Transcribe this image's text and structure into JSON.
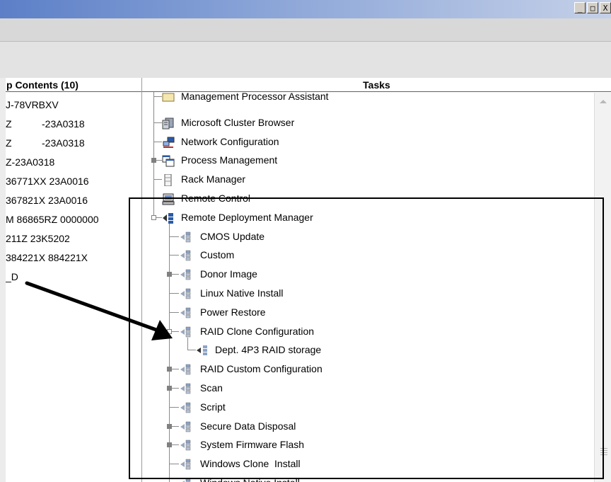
{
  "window": {
    "buttons": [
      "_",
      "□",
      "X"
    ]
  },
  "left_pane": {
    "header": "p Contents (10)",
    "rows": [
      {
        "c1": "J-78VRBXV",
        "c2": ""
      },
      {
        "c1": "Z",
        "c2": "-23A0318"
      },
      {
        "c1": "Z",
        "c2": "-23A0318"
      },
      {
        "c1": "Z-23A0318",
        "c2": ""
      },
      {
        "c1": "36771XX 23A0016",
        "c2": ""
      },
      {
        "c1": "367821X 23A0016",
        "c2": ""
      },
      {
        "c1": "M 86865RZ 0000000",
        "c2": ""
      },
      {
        "c1": "211Z 23K5202",
        "c2": ""
      },
      {
        "c1": "384221X 884221X",
        "c2": ""
      },
      {
        "c1": "_D",
        "c2": ""
      }
    ]
  },
  "tasks_pane": {
    "header": "Tasks",
    "items": [
      {
        "label": "Management Processor Assistant",
        "icon": "folder-icon"
      },
      {
        "label": "Microsoft Cluster Browser",
        "icon": "cluster-icon"
      },
      {
        "label": "Network Configuration",
        "icon": "network-icon"
      },
      {
        "label": "Process Management",
        "icon": "windows-icon"
      },
      {
        "label": "Rack Manager",
        "icon": "rack-icon"
      },
      {
        "label": "Remote Control",
        "icon": "monitor-icon"
      },
      {
        "label": "Remote Deployment Manager",
        "icon": "rdm-icon"
      },
      {
        "label": "CMOS Update",
        "icon": "rdm-task-icon"
      },
      {
        "label": "Custom",
        "icon": "rdm-task-icon"
      },
      {
        "label": "Donor Image",
        "icon": "rdm-task-icon"
      },
      {
        "label": "Linux Native Install",
        "icon": "rdm-task-icon"
      },
      {
        "label": "Power Restore",
        "icon": "rdm-task-icon"
      },
      {
        "label": "RAID Clone Configuration",
        "icon": "rdm-task-icon"
      },
      {
        "label": "Dept. 4P3 RAID storage",
        "icon": "rdm-job-icon"
      },
      {
        "label": "RAID Custom Configuration",
        "icon": "rdm-task-icon"
      },
      {
        "label": "Scan",
        "icon": "rdm-task-icon"
      },
      {
        "label": "Script",
        "icon": "rdm-task-icon"
      },
      {
        "label": "Secure Data Disposal",
        "icon": "rdm-task-icon"
      },
      {
        "label": "System Firmware Flash",
        "icon": "rdm-task-icon"
      },
      {
        "label": "Windows Clone  Install",
        "icon": "rdm-task-icon"
      },
      {
        "label": "Windows Native Install",
        "icon": "rdm-task-icon"
      }
    ]
  },
  "colors": {
    "titlebar_start": "#5c7fc7",
    "titlebar_end": "#c4d0e8",
    "tree_line": "#8a8a8a",
    "icon_blue": "#2a5aa8",
    "annotation": "#000000"
  }
}
